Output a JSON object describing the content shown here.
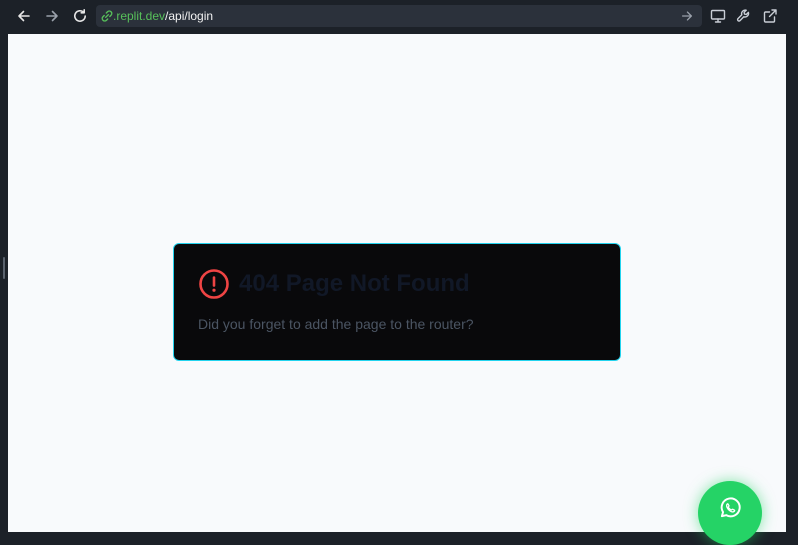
{
  "browser": {
    "url_domain": ".replit.dev",
    "url_path": "/api/login",
    "icons": {
      "back": "arrow-left-icon",
      "forward": "arrow-right-icon",
      "reload": "reload-icon",
      "link": "link-icon",
      "go": "arrow-right-icon",
      "devices": "monitor-icon",
      "devtools": "wrench-icon",
      "open_external": "external-link-icon"
    }
  },
  "error_card": {
    "title": "404 Page Not Found",
    "message": "Did you forget to add the page to the router?",
    "icon": "alert-circle-icon",
    "accent_color": "#ef4444",
    "border_color": "#22d3ee"
  },
  "floating_action": {
    "icon": "whatsapp-icon",
    "color": "#25d366"
  }
}
